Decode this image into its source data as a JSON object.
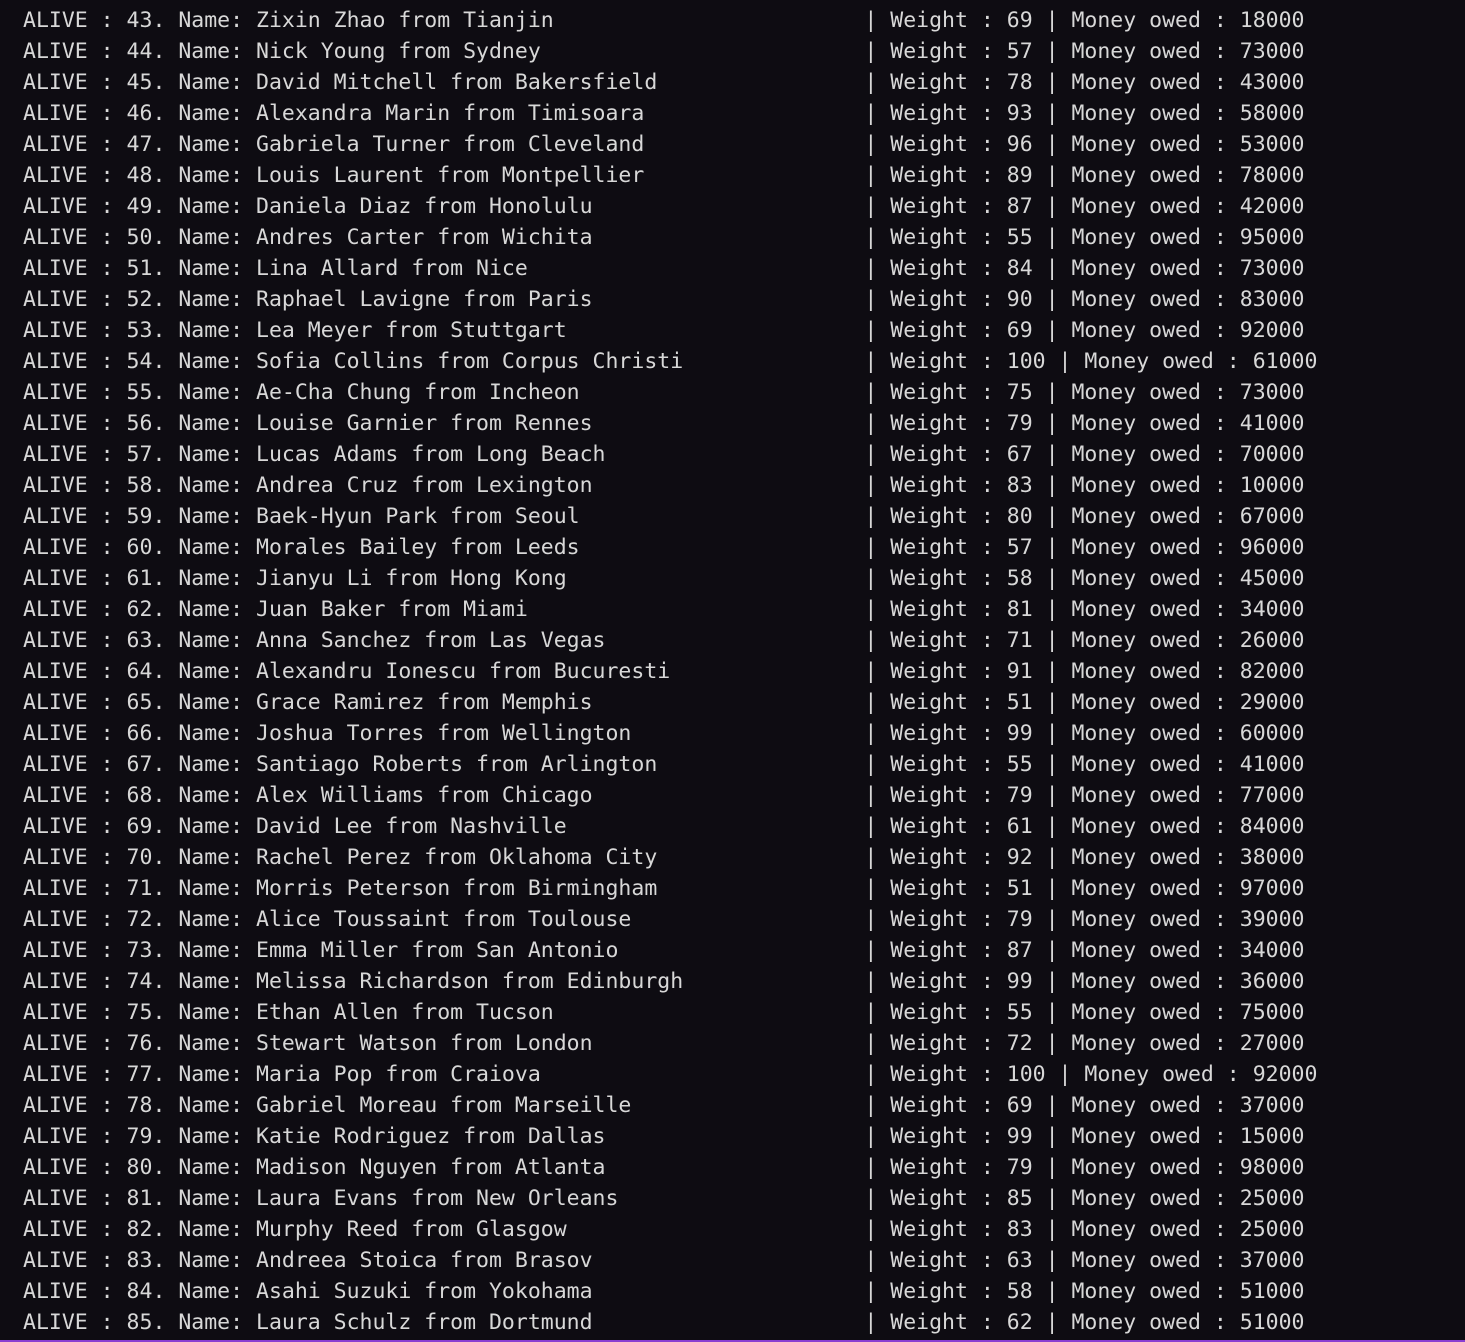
{
  "terminal": {
    "lines": [
      "ALIVE : 43. Name: Zixin Zhao from Tianjin                        | Weight : 69 | Money owed : 18000",
      "ALIVE : 44. Name: Nick Young from Sydney                         | Weight : 57 | Money owed : 73000",
      "ALIVE : 45. Name: David Mitchell from Bakersfield                | Weight : 78 | Money owed : 43000",
      "ALIVE : 46. Name: Alexandra Marin from Timisoara                 | Weight : 93 | Money owed : 58000",
      "ALIVE : 47. Name: Gabriela Turner from Cleveland                 | Weight : 96 | Money owed : 53000",
      "ALIVE : 48. Name: Louis Laurent from Montpellier                 | Weight : 89 | Money owed : 78000",
      "ALIVE : 49. Name: Daniela Diaz from Honolulu                     | Weight : 87 | Money owed : 42000",
      "ALIVE : 50. Name: Andres Carter from Wichita                     | Weight : 55 | Money owed : 95000",
      "ALIVE : 51. Name: Lina Allard from Nice                          | Weight : 84 | Money owed : 73000",
      "ALIVE : 52. Name: Raphael Lavigne from Paris                     | Weight : 90 | Money owed : 83000",
      "ALIVE : 53. Name: Lea Meyer from Stuttgart                       | Weight : 69 | Money owed : 92000",
      "ALIVE : 54. Name: Sofia Collins from Corpus Christi              | Weight : 100 | Money owed : 61000",
      "ALIVE : 55. Name: Ae-Cha Chung from Incheon                      | Weight : 75 | Money owed : 73000",
      "ALIVE : 56. Name: Louise Garnier from Rennes                     | Weight : 79 | Money owed : 41000",
      "ALIVE : 57. Name: Lucas Adams from Long Beach                    | Weight : 67 | Money owed : 70000",
      "ALIVE : 58. Name: Andrea Cruz from Lexington                     | Weight : 83 | Money owed : 10000",
      "ALIVE : 59. Name: Baek-Hyun Park from Seoul                      | Weight : 80 | Money owed : 67000",
      "ALIVE : 60. Name: Morales Bailey from Leeds                      | Weight : 57 | Money owed : 96000",
      "ALIVE : 61. Name: Jianyu Li from Hong Kong                       | Weight : 58 | Money owed : 45000",
      "ALIVE : 62. Name: Juan Baker from Miami                          | Weight : 81 | Money owed : 34000",
      "ALIVE : 63. Name: Anna Sanchez from Las Vegas                    | Weight : 71 | Money owed : 26000",
      "ALIVE : 64. Name: Alexandru Ionescu from Bucuresti               | Weight : 91 | Money owed : 82000",
      "ALIVE : 65. Name: Grace Ramirez from Memphis                     | Weight : 51 | Money owed : 29000",
      "ALIVE : 66. Name: Joshua Torres from Wellington                  | Weight : 99 | Money owed : 60000",
      "ALIVE : 67. Name: Santiago Roberts from Arlington                | Weight : 55 | Money owed : 41000",
      "ALIVE : 68. Name: Alex Williams from Chicago                     | Weight : 79 | Money owed : 77000",
      "ALIVE : 69. Name: David Lee from Nashville                       | Weight : 61 | Money owed : 84000",
      "ALIVE : 70. Name: Rachel Perez from Oklahoma City                | Weight : 92 | Money owed : 38000",
      "ALIVE : 71. Name: Morris Peterson from Birmingham                | Weight : 51 | Money owed : 97000",
      "ALIVE : 72. Name: Alice Toussaint from Toulouse                  | Weight : 79 | Money owed : 39000",
      "ALIVE : 73. Name: Emma Miller from San Antonio                   | Weight : 87 | Money owed : 34000",
      "ALIVE : 74. Name: Melissa Richardson from Edinburgh              | Weight : 99 | Money owed : 36000",
      "ALIVE : 75. Name: Ethan Allen from Tucson                        | Weight : 55 | Money owed : 75000",
      "ALIVE : 76. Name: Stewart Watson from London                     | Weight : 72 | Money owed : 27000",
      "ALIVE : 77. Name: Maria Pop from Craiova                         | Weight : 100 | Money owed : 92000",
      "ALIVE : 78. Name: Gabriel Moreau from Marseille                  | Weight : 69 | Money owed : 37000",
      "ALIVE : 79. Name: Katie Rodriguez from Dallas                    | Weight : 99 | Money owed : 15000",
      "ALIVE : 80. Name: Madison Nguyen from Atlanta                    | Weight : 79 | Money owed : 98000",
      "ALIVE : 81. Name: Laura Evans from New Orleans                   | Weight : 85 | Money owed : 25000",
      "ALIVE : 82. Name: Murphy Reed from Glasgow                       | Weight : 83 | Money owed : 25000",
      "ALIVE : 83. Name: Andreea Stoica from Brasov                     | Weight : 63 | Money owed : 37000",
      "ALIVE : 84. Name: Asahi Suzuki from Yokohama                     | Weight : 58 | Money owed : 51000",
      "ALIVE : 85. Name: Laura Schulz from Dortmund                     | Weight : 62 | Money owed : 51000"
    ]
  },
  "colors": {
    "background": "#0e0c12",
    "text": "#d8d8d8",
    "accent_border": "#8a3fd1"
  }
}
